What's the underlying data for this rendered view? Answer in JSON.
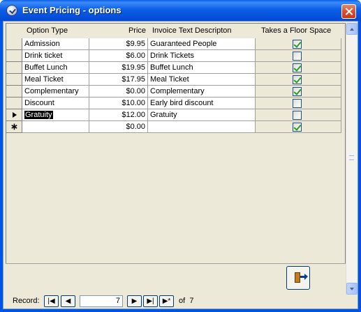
{
  "window": {
    "title": "Event Pricing - options"
  },
  "table": {
    "columns": [
      "Option Type",
      "Price",
      "Invoice Text Descripton",
      "Takes a Floor Space"
    ],
    "rows": [
      {
        "type": "Admission",
        "price": "$9.95",
        "invoice": "Guaranteed People",
        "floor": true
      },
      {
        "type": "Drink ticket",
        "price": "$6.00",
        "invoice": "Drink Tickets",
        "floor": false
      },
      {
        "type": "Buffet Lunch",
        "price": "$19.95",
        "invoice": "Buffet Lunch",
        "floor": true
      },
      {
        "type": "Meal Ticket",
        "price": "$17.95",
        "invoice": "Meal Ticket",
        "floor": true
      },
      {
        "type": "Complementary",
        "price": "$0.00",
        "invoice": "Complementary",
        "floor": true
      },
      {
        "type": "Discount",
        "price": "$10.00",
        "invoice": "Early bird discount",
        "floor": false
      },
      {
        "type": "Gratuity",
        "price": "$12.00",
        "invoice": "Gratuity",
        "floor": false
      },
      {
        "type": "",
        "price": "$0.00",
        "invoice": "",
        "floor": true
      }
    ]
  },
  "navigation": {
    "record_label": "Record:",
    "current": "7",
    "of_label": "of",
    "total": "7"
  },
  "icons": [
    "check-icon",
    "record-pointer-icon",
    "new-record-icon",
    "exit-door-icon"
  ]
}
